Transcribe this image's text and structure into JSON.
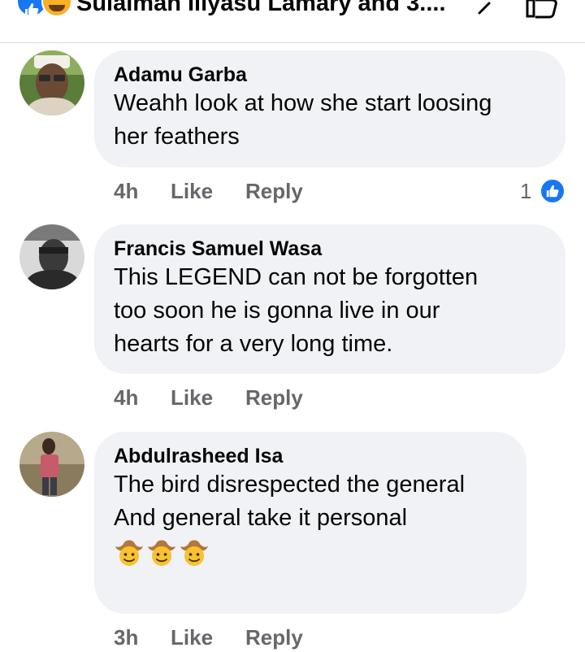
{
  "header": {
    "reactors_text": "Sulaiman Iliyasu Lamary and 3....",
    "reaction_icons": [
      "like-reaction-icon",
      "haha-reaction-icon"
    ],
    "chevron_icon": "chevron-right-icon",
    "like_icon": "like-outline-icon"
  },
  "comments": [
    {
      "author": "Adamu Garba",
      "lines": [
        "Weahh look at how she start loosing",
        "her feathers"
      ],
      "time": "4h",
      "like_label": "Like",
      "reply_label": "Reply",
      "reaction_count": "1",
      "reaction_icon": "like-reaction-icon"
    },
    {
      "author": "Francis Samuel Wasa",
      "lines": [
        "This LEGEND can not be forgotten",
        "too soon he is gonna live in our",
        "hearts for a very long time."
      ],
      "time": "4h",
      "like_label": "Like",
      "reply_label": "Reply"
    },
    {
      "author": "Abdulrasheed Isa",
      "lines": [
        "The bird disrespected the general",
        "And general take it personal"
      ],
      "emojis": [
        "cowboy-emoji",
        "cowboy-emoji",
        "cowboy-emoji"
      ],
      "time": "3h",
      "like_label": "Like",
      "reply_label": "Reply"
    }
  ],
  "colors": {
    "bubble_bg": "#f0f2f5",
    "meta_text": "#65676b",
    "facebook_blue": "#1877f2",
    "haha_yellow": "#f7b125"
  }
}
